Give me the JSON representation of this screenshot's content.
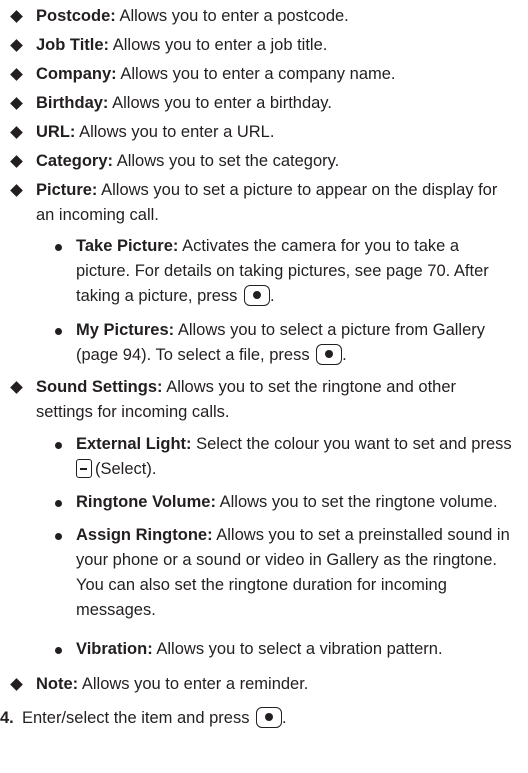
{
  "items": [
    {
      "title": "Postcode:",
      "text": "Allows you to enter a postcode."
    },
    {
      "title": "Job Title:",
      "text": "Allows you to enter a job title."
    },
    {
      "title": "Company:",
      "text": "Allows you to enter a company name."
    },
    {
      "title": "Birthday:",
      "text": "Allows you to enter a birthday."
    },
    {
      "title": "URL:",
      "text": "Allows you to enter a URL."
    },
    {
      "title": "Category:",
      "text": "Allows you to set the category."
    },
    {
      "title": "Picture:",
      "text": "Allows you to set a picture to appear on the display for an incoming call."
    },
    {
      "title": "Sound Settings:",
      "text": "Allows you to set the ringtone and other settings for incoming calls."
    },
    {
      "title": "Note:",
      "text": "Allows you to enter a reminder."
    }
  ],
  "picture_sub": [
    {
      "title": "Take Picture:",
      "text": "Activates the camera for you to take a picture. For details on taking pictures, see page 70. After taking a picture, press"
    },
    {
      "title": "My Pictures:",
      "text": "Allows you to select a picture from Gallery (page 94). To select a file, press"
    }
  ],
  "sound_sub": [
    {
      "title": "External Light:",
      "text": "Select the colour you want to set and press",
      "tail": "(Select)."
    },
    {
      "title": "Ringtone Volume:",
      "text": "Allows you to set the ringtone volume."
    },
    {
      "title": "Assign Ringtone:",
      "text": "Allows you to set a preinstalled sound in your phone or a sound or video in Gallery as the ringtone. You can also set the ringtone duration for incoming messages."
    },
    {
      "title": "Vibration:",
      "text": "Allows you to select a vibration pattern."
    }
  ],
  "step": {
    "number": "4.",
    "text": "Enter/select the item and press"
  }
}
